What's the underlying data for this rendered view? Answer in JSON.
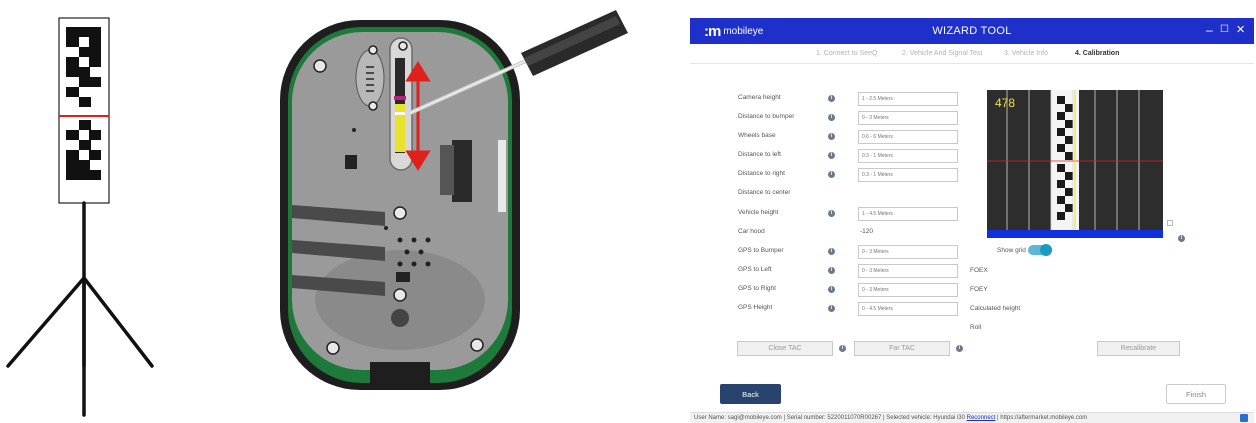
{
  "window": {
    "logo_text": "mobileye",
    "title": "WIZARD TOOL",
    "controls": {
      "minimize": "–",
      "maximize": "☐",
      "close": "✕"
    }
  },
  "steps": [
    {
      "label": "1. Connect to SeeQ",
      "active": false
    },
    {
      "label": "2. Vehicle And Signal Test",
      "active": false
    },
    {
      "label": "3. Vehicle Info",
      "active": false
    },
    {
      "label": "4. Calibration",
      "active": true
    }
  ],
  "form": {
    "camera_height": {
      "label": "Camera height",
      "placeholder": "1 - 2.5 Meters"
    },
    "distance_to_bumper": {
      "label": "Distance to bumper",
      "placeholder": "0 - 3 Meters"
    },
    "wheels_base": {
      "label": "Wheels base",
      "placeholder": "0.6 - 6 Meters"
    },
    "distance_to_left": {
      "label": "Distance to left",
      "placeholder": "0.3 - 1 Meters"
    },
    "distance_to_right": {
      "label": "Distance to right",
      "placeholder": "0.3 - 1 Meters"
    },
    "distance_to_center": {
      "label": "Distance to center"
    },
    "vehicle_height": {
      "label": "Vehicle height",
      "placeholder": "1 - 4.5 Meters"
    },
    "car_hood": {
      "label": "Car hood",
      "value": "-120"
    },
    "gps_to_bumper": {
      "label": "GPS to Bumper",
      "placeholder": "0 - 3 Meters"
    },
    "gps_to_left": {
      "label": "GPS to Left",
      "placeholder": "0 - 3 Meters"
    },
    "gps_to_right": {
      "label": "GPS to Right",
      "placeholder": "0 - 3 Meters"
    },
    "gps_height": {
      "label": "GPS Height",
      "placeholder": "0 - 4.5 Meters"
    }
  },
  "results": {
    "foex": "FOEX",
    "foey": "FOEY",
    "calculated_height": "Calculated height",
    "roll": "Roll"
  },
  "camera": {
    "frame_number": "478",
    "show_grid_label": "Show grid",
    "show_grid_on": true
  },
  "buttons": {
    "close_tac": "Close TAC",
    "far_tac": "Far TAC",
    "recalibrate": "Recalibrate",
    "back": "Back",
    "finish": "Finish"
  },
  "status_bar": {
    "user_name": "User Name:  sagi@mobileye.com",
    "serial_number": "Serial number:  5220011070R00267",
    "selected_vehicle": "Selected vehicle:  Hyundai i30",
    "reconnect": "Reconnect",
    "url": "https://aftermarket.mobileye.com"
  },
  "colors": {
    "titlebar": "#1f2fc9",
    "back_button": "#27436e",
    "toggle": "#1a9cc0",
    "device_body": "#9a9a9a",
    "device_rim": "#1e1e1e",
    "pcb_green": "#1e7a3a",
    "arrow_red": "#e0201a",
    "slider_yellow": "#e8e32a",
    "cam_horizon": "#e02020",
    "cam_strip": "#1030e0"
  },
  "icons": {
    "window_info": "info-icon",
    "screwdriver": "screwdriver-icon",
    "status": "save-icon"
  }
}
